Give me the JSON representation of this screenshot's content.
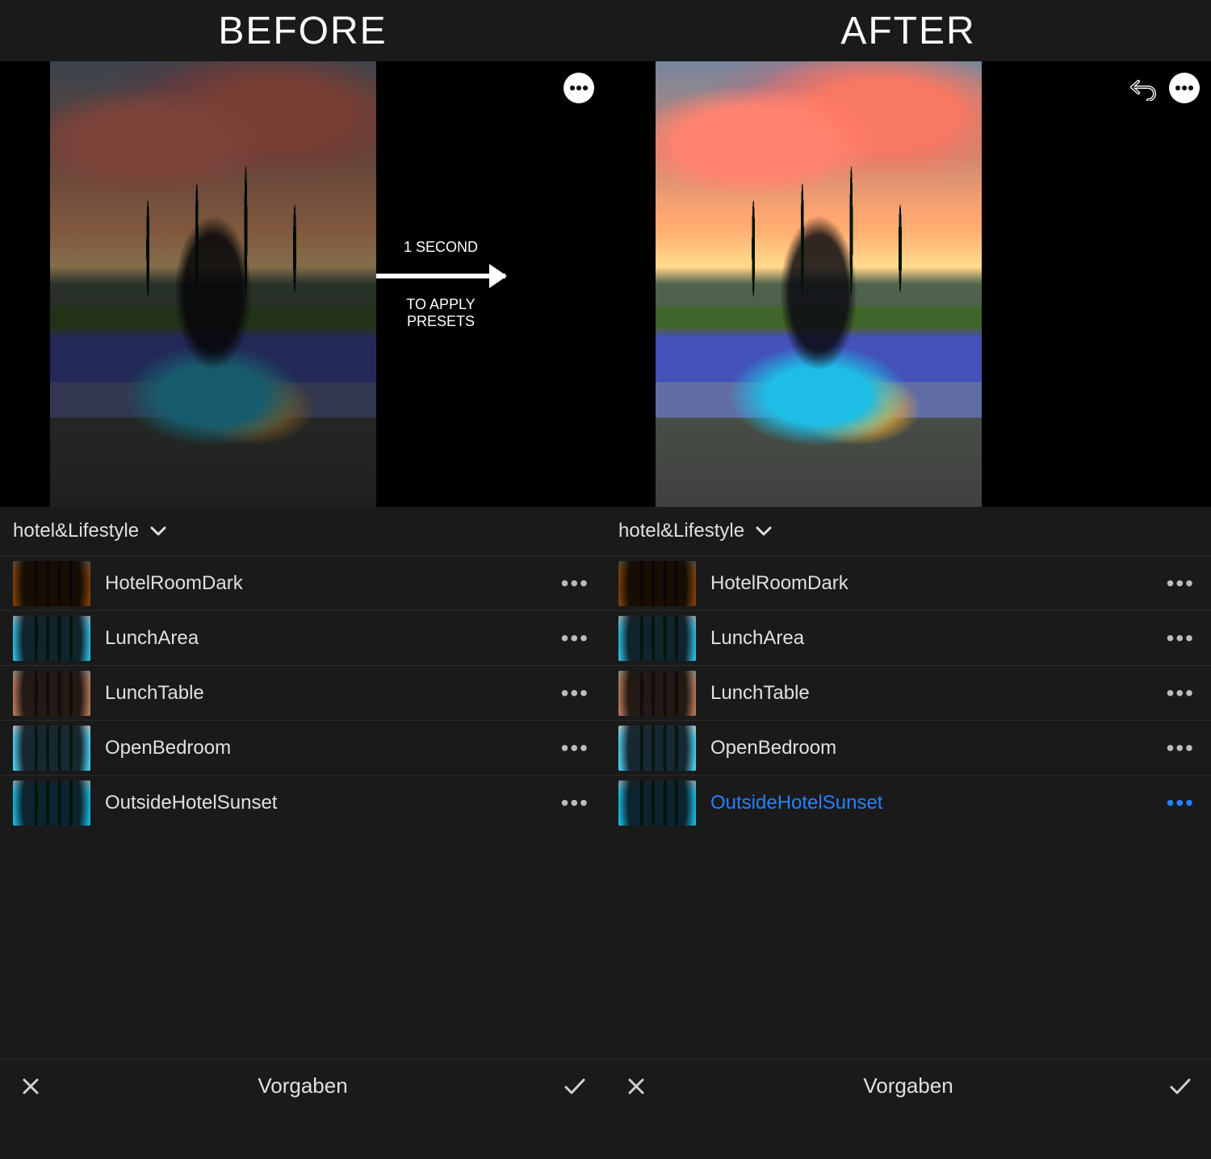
{
  "header": {
    "before": "BEFORE",
    "after": "AFTER"
  },
  "center": {
    "line1": "1 SECOND",
    "line2": "TO APPLY PRESETS"
  },
  "before_panel": {
    "preset_group": "hotel&Lifestyle",
    "presets": [
      {
        "name": "HotelRoomDark",
        "selected": false
      },
      {
        "name": "LunchArea",
        "selected": false
      },
      {
        "name": "LunchTable",
        "selected": false
      },
      {
        "name": "OpenBedroom",
        "selected": false
      },
      {
        "name": "OutsideHotelSunset",
        "selected": false
      }
    ],
    "bottom": {
      "title": "Vorgaben"
    }
  },
  "after_panel": {
    "preset_group": "hotel&Lifestyle",
    "presets": [
      {
        "name": "HotelRoomDark",
        "selected": false
      },
      {
        "name": "LunchArea",
        "selected": false
      },
      {
        "name": "LunchTable",
        "selected": false
      },
      {
        "name": "OpenBedroom",
        "selected": false
      },
      {
        "name": "OutsideHotelSunset",
        "selected": true
      }
    ],
    "bottom": {
      "title": "Vorgaben"
    }
  },
  "icons": {
    "more": "•••",
    "chevron_down": "chevron-down",
    "close": "close",
    "check": "check",
    "undo": "undo"
  },
  "colors": {
    "accent": "#2680ff"
  }
}
